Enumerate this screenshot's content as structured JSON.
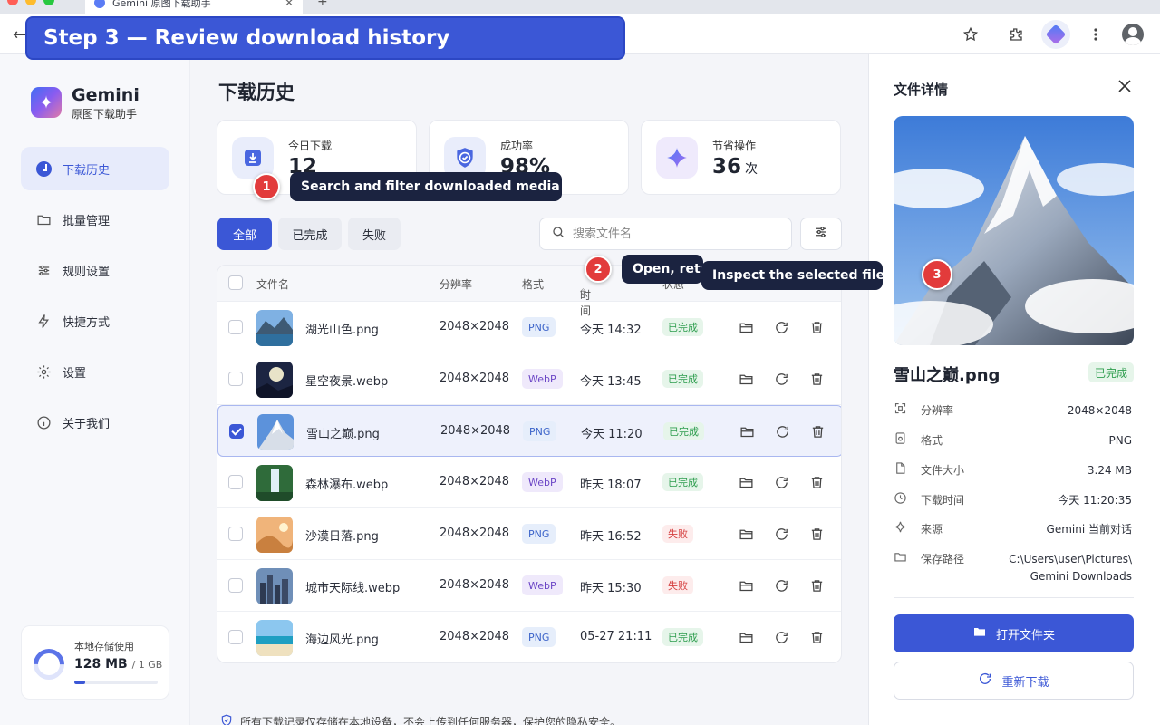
{
  "browser": {
    "tab_title": "Gemini 原图下载助手",
    "tab_close": "✕",
    "new_tab": "+"
  },
  "step_banner": "Step 3 — Review download history",
  "sidebar": {
    "app_name": "Gemini",
    "app_subtitle": "原图下载助手",
    "items": [
      {
        "label": "下载历史",
        "icon": "clock-icon",
        "active": true
      },
      {
        "label": "批量管理",
        "icon": "folder-icon"
      },
      {
        "label": "规则设置",
        "icon": "sliders-icon"
      },
      {
        "label": "快捷方式",
        "icon": "lightning-icon"
      },
      {
        "label": "设置",
        "icon": "gear-icon"
      },
      {
        "label": "关于我们",
        "icon": "info-icon"
      }
    ],
    "storage": {
      "title": "本地存储使用",
      "used": "128 MB",
      "total": "/ 1 GB",
      "fraction": 0.125
    }
  },
  "main": {
    "title": "下载历史",
    "stats": [
      {
        "label": "今日下载",
        "value": "12",
        "unit": ""
      },
      {
        "label": "成功率",
        "value": "98%",
        "unit": ""
      },
      {
        "label": "节省操作",
        "value": "36",
        "unit": "次"
      }
    ],
    "filters": [
      "全部",
      "已完成",
      "失败"
    ],
    "search_placeholder": "搜索文件名",
    "columns": {
      "name": "文件名",
      "resolution": "分辨率",
      "format": "格式",
      "time": "时间",
      "status": "状态"
    },
    "rows": [
      {
        "name": "湖光山色.png",
        "resolution": "2048×2048",
        "format": "PNG",
        "time": "今天 14:32",
        "status": "已完成",
        "thumb": "lake",
        "checked": false
      },
      {
        "name": "星空夜景.webp",
        "resolution": "2048×2048",
        "format": "WebP",
        "time": "今天 13:45",
        "status": "已完成",
        "thumb": "moon",
        "checked": false
      },
      {
        "name": "雪山之巅.png",
        "resolution": "2048×2048",
        "format": "PNG",
        "time": "今天 11:20",
        "status": "已完成",
        "thumb": "snow",
        "checked": true
      },
      {
        "name": "森林瀑布.webp",
        "resolution": "2048×2048",
        "format": "WebP",
        "time": "昨天 18:07",
        "status": "已完成",
        "thumb": "forest",
        "checked": false
      },
      {
        "name": "沙漠日落.png",
        "resolution": "2048×2048",
        "format": "PNG",
        "time": "昨天 16:52",
        "status": "失败",
        "thumb": "desert",
        "checked": false
      },
      {
        "name": "城市天际线.webp",
        "resolution": "2048×2048",
        "format": "WebP",
        "time": "昨天 15:30",
        "status": "失败",
        "thumb": "city",
        "checked": false
      },
      {
        "name": "海边风光.png",
        "resolution": "2048×2048",
        "format": "PNG",
        "time": "05-27 21:11",
        "status": "已完成",
        "thumb": "beach",
        "checked": false
      }
    ],
    "privacy_note": "所有下载记录仅存储在本地设备，不会上传到任何服务器，保护您的隐私安全。"
  },
  "details": {
    "title": "文件详情",
    "file_name": "雪山之巅.png",
    "status": "已完成",
    "fields": [
      {
        "label": "分辨率",
        "value": "2048×2048",
        "icon": "resolution-icon"
      },
      {
        "label": "格式",
        "value": "PNG",
        "icon": "file-format-icon"
      },
      {
        "label": "文件大小",
        "value": "3.24 MB",
        "icon": "file-size-icon"
      },
      {
        "label": "下载时间",
        "value": "今天 11:20:35",
        "icon": "clock-icon"
      },
      {
        "label": "来源",
        "value": "Gemini 当前对话",
        "icon": "sparkle-icon"
      },
      {
        "label": "保存路径",
        "value": "C:\\Users\\user\\Pictures\\ Gemini Downloads",
        "icon": "folder-icon"
      }
    ],
    "open_folder": "打开文件夹",
    "redownload": "重新下载"
  },
  "callouts": [
    {
      "number": "1",
      "text": "Search and filter downloaded media"
    },
    {
      "number": "2",
      "text": "Open, retry, or delete files"
    },
    {
      "number": "3",
      "text": "Inspect the selected file"
    }
  ],
  "colors": {
    "accent": "#3b57d6",
    "success": "#2f9e4f",
    "danger": "#d54141",
    "callout": "#e23b3b",
    "tooltip": "#1b2340"
  }
}
